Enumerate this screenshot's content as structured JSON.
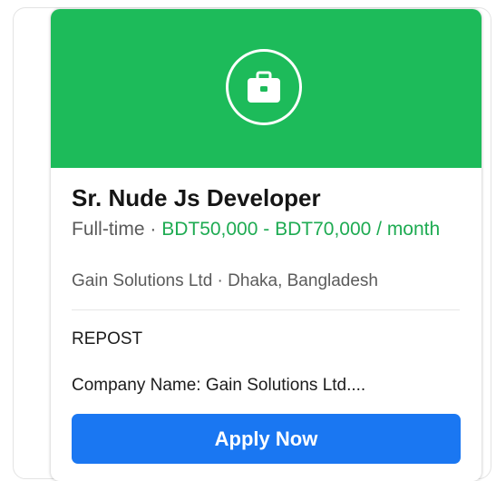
{
  "job": {
    "icon": "briefcase-icon",
    "title": "Sr. Nude Js Developer",
    "employment_type": "Full-time",
    "separator": " · ",
    "salary": "BDT50,000 - BDT70,000 / month",
    "company": "Gain Solutions Ltd",
    "location": "Dhaka, Bangladesh",
    "repost_label": "REPOST",
    "description_preview": "Company Name: Gain Solutions Ltd...."
  },
  "actions": {
    "apply_label": "Apply Now"
  },
  "colors": {
    "banner": "#1dbb5a",
    "salary": "#1eab52",
    "apply_button": "#1a77f2"
  }
}
